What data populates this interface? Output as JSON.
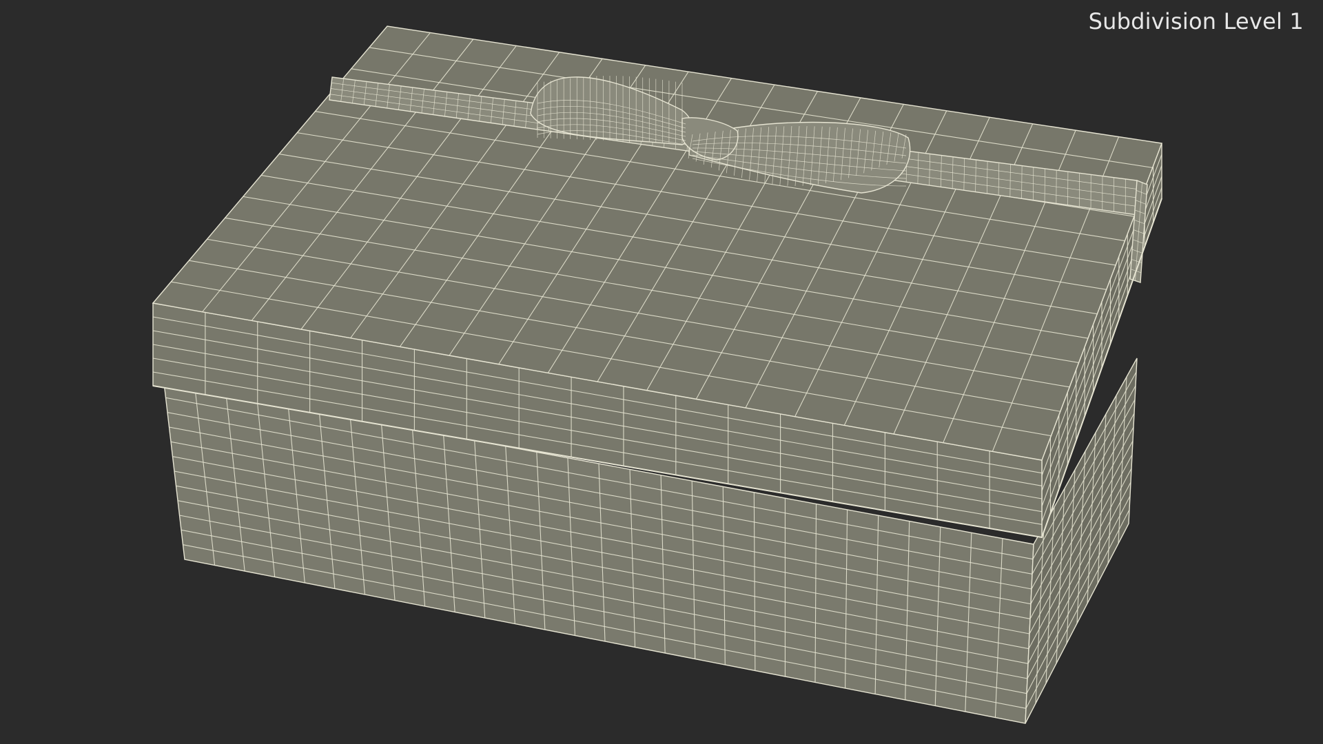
{
  "viewport": {
    "overlay_label": "Subdivision Level 1",
    "render_mode": "wireframe-on-shaded",
    "subject": "gift box with ribbon bow",
    "colors": {
      "background": "#2b2b2b",
      "top_face": "#77776a",
      "front_face": "#7a7a6d",
      "side_face": "#6d6d61",
      "lid_front": "#78786b",
      "wire": "#e6e4d2",
      "ribbon": "#8a8a7c"
    }
  }
}
